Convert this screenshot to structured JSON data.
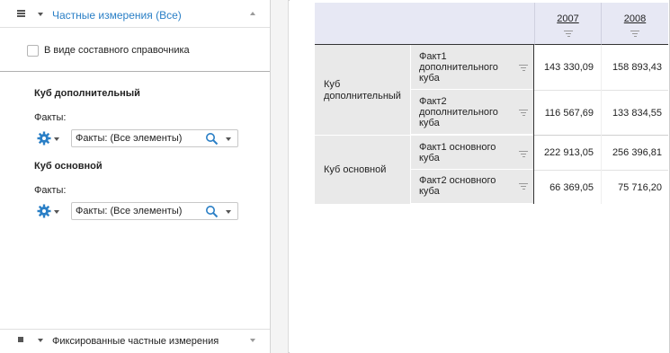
{
  "left_panel": {
    "header_title": "Частные измерения (Все)",
    "composite_label": "В виде составного справочника",
    "cubes": [
      {
        "title": "Куб дополнительный",
        "facts_label": "Факты:",
        "select_value": "Факты: (Все элементы)"
      },
      {
        "title": "Куб основной",
        "facts_label": "Факты:",
        "select_value": "Факты: (Все элементы)"
      }
    ],
    "footer_title": "Фиксированные частные измерения"
  },
  "table": {
    "columns": [
      "2007",
      "2008"
    ],
    "groups": [
      {
        "cube": "Куб дополнительный",
        "rows": [
          {
            "fact": "Факт1 дополнительного куба",
            "values": [
              "143 330,09",
              "158 893,43"
            ]
          },
          {
            "fact": "Факт2 дополнительного куба",
            "values": [
              "116 567,69",
              "133 834,55"
            ]
          }
        ]
      },
      {
        "cube": "Куб основной",
        "rows": [
          {
            "fact": "Факт1 основного куба",
            "values": [
              "222 913,05",
              "256 396,81"
            ]
          },
          {
            "fact": "Факт2 основного куба",
            "values": [
              "66 369,05",
              "75 716,20"
            ]
          }
        ]
      }
    ]
  },
  "colors": {
    "accent": "#2a7fc6",
    "header_bg": "#e7e8f4",
    "row_header_bg": "#e9e9e9"
  },
  "icons": [
    "menu-icon",
    "chevron-down-icon",
    "chevron-up-icon",
    "gear-icon",
    "search-icon",
    "filter-icon",
    "square-icon"
  ]
}
